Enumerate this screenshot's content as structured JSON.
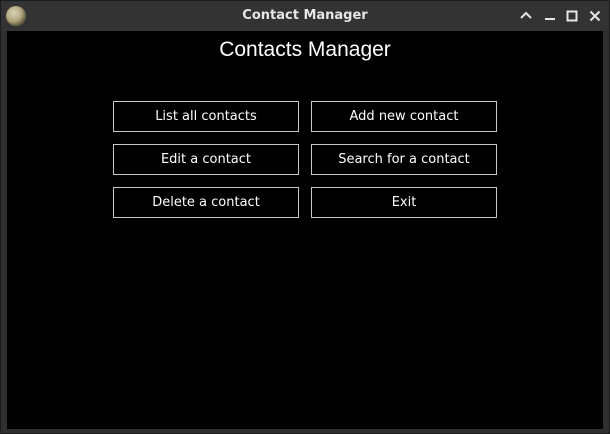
{
  "window": {
    "title": "Contact Manager",
    "controls": {
      "up_icon": "chevron-up-icon",
      "minimize_icon": "minimize-icon",
      "maximize_icon": "maximize-icon",
      "close_icon": "close-icon"
    }
  },
  "main": {
    "heading": "Contacts Manager",
    "buttons": [
      {
        "label": "List all contacts"
      },
      {
        "label": "Add new contact"
      },
      {
        "label": "Edit a contact"
      },
      {
        "label": "Search for a contact"
      },
      {
        "label": "Delete a contact"
      },
      {
        "label": "Exit"
      }
    ]
  },
  "colors": {
    "background": "#000000",
    "button_border": "#c8c8c8",
    "text": "#ffffff",
    "titlebar": "#333333"
  }
}
